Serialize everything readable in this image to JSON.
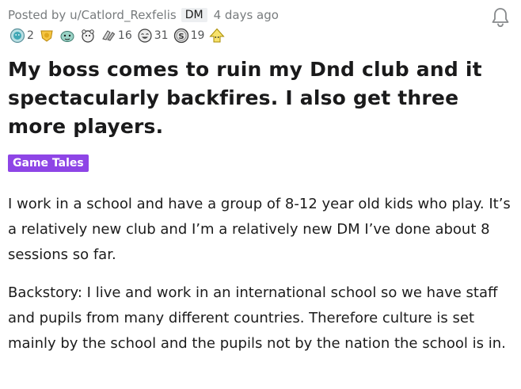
{
  "meta": {
    "posted_by": "Posted by u/Catlord_Rexfelis",
    "user_flair": "DM",
    "time_ago": "4 days ago"
  },
  "awards": [
    {
      "icon": "wholesome-seal-award-icon",
      "count": "2"
    },
    {
      "icon": "gold-trophy-award-icon",
      "count": ""
    },
    {
      "icon": "party-dragon-award-icon",
      "count": ""
    },
    {
      "icon": "hugz-bear-award-icon",
      "count": ""
    },
    {
      "icon": "helpful-hands-award-icon",
      "count": "16"
    },
    {
      "icon": "laughing-face-award-icon",
      "count": "31"
    },
    {
      "icon": "silver-coin-award-icon",
      "count": "19"
    },
    {
      "icon": "takes-my-energy-award-icon",
      "count": ""
    }
  ],
  "post": {
    "title": "My boss comes to ruin my Dnd club and it spectacularly backfires. I also get three more players.",
    "flair": "Game Tales",
    "paragraphs": [
      "I work in a school and have a group of 8-12 year old kids who play. It’s a relatively new club and I’m a relatively new DM I’ve done about 8 sessions so far.",
      "Backstory: I live and work in an international school so we have staff and pupils from many different countries. Therefore culture is set mainly by the school and the pupils not by the nation the school is in."
    ]
  },
  "colors": {
    "flair_purple": "#8e45e6",
    "meta_gray": "#787c7e",
    "text_dark": "#1c1c1c",
    "dm_flair_bg": "#edeff1"
  }
}
